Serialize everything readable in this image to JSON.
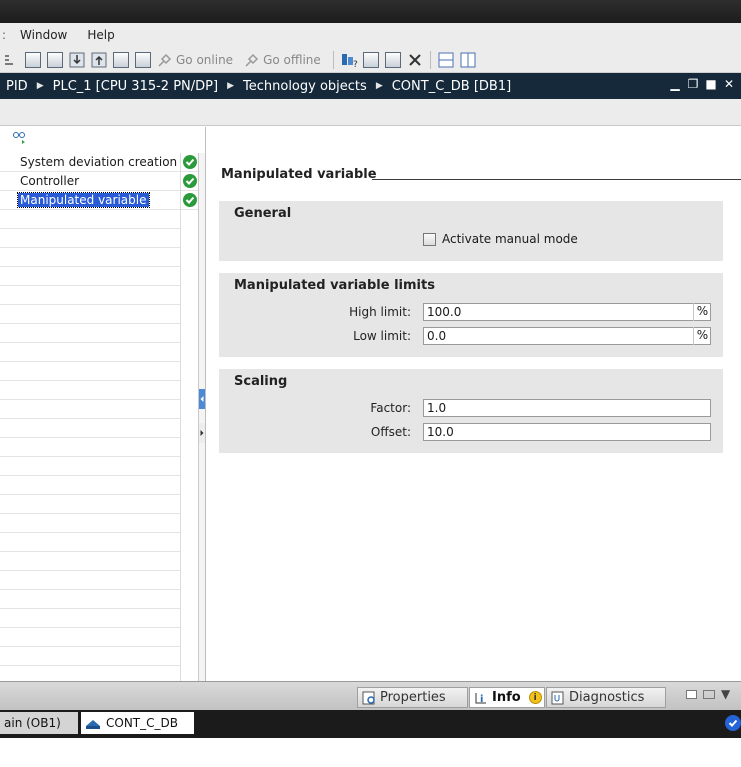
{
  "menu": {
    "fragment": ":",
    "items": [
      "Window",
      "Help"
    ]
  },
  "toolbar": {
    "go_online": "Go online",
    "go_offline": "Go offline"
  },
  "breadcrumb": [
    "PID",
    "PLC_1 [CPU 315-2 PN/DP]",
    "Technology objects",
    "CONT_C_DB [DB1]"
  ],
  "nav": {
    "items": [
      {
        "label": "System deviation creation",
        "status": "ok"
      },
      {
        "label": "Controller",
        "status": "ok"
      },
      {
        "label": "Manipulated variable",
        "status": "ok",
        "selected": true
      }
    ]
  },
  "content": {
    "title": "Manipulated variable",
    "general": {
      "title": "General",
      "manual_mode_label": "Activate manual mode",
      "manual_mode_checked": false
    },
    "limits": {
      "title": "Manipulated variable limits",
      "high_label": "High limit:",
      "high_value": "100.0",
      "high_unit": "%",
      "low_label": "Low limit:",
      "low_value": "0.0",
      "low_unit": "%"
    },
    "scaling": {
      "title": "Scaling",
      "factor_label": "Factor:",
      "factor_value": "1.0",
      "offset_label": "Offset:",
      "offset_value": "10.0"
    }
  },
  "inspector_tabs": {
    "properties": "Properties",
    "info": "Info",
    "diagnostics": "Diagnostics"
  },
  "taskbar": {
    "item1": "ain (OB1)",
    "item2": "CONT_C_DB"
  },
  "colors": {
    "path_bar": "#15293a",
    "selection": "#2a5bd7",
    "ok_green": "#2b9a3a",
    "section_bg": "#e6e6e6"
  }
}
